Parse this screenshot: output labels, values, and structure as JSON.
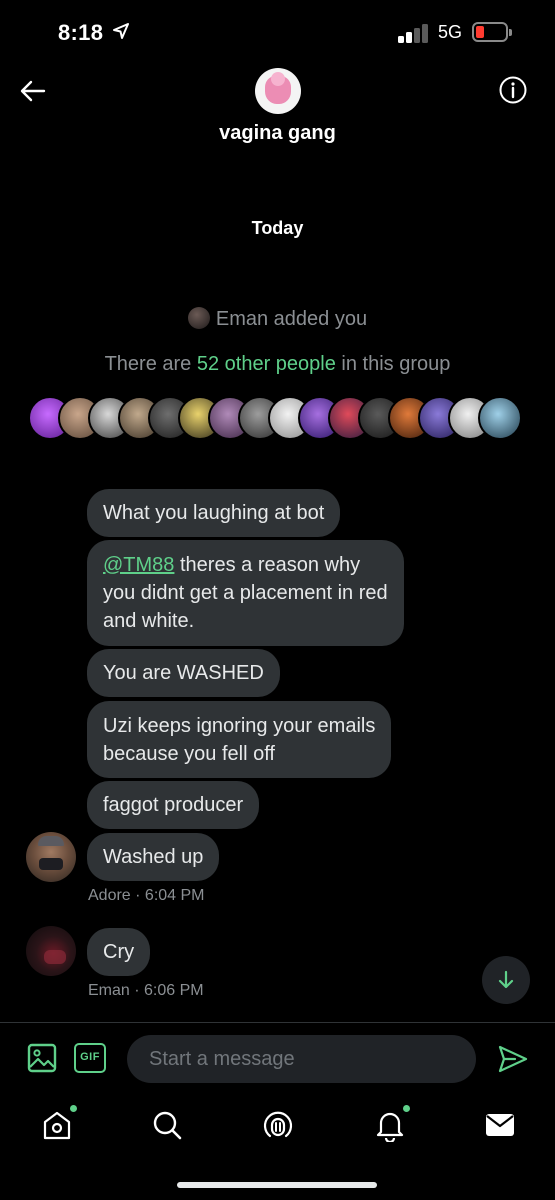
{
  "status_bar": {
    "time": "8:18",
    "network": "5G"
  },
  "header": {
    "group_name": "vagina gang"
  },
  "conversation": {
    "date_separator": "Today",
    "added_event": "Eman added you",
    "members_prefix": "There are ",
    "members_link": "52 other people",
    "members_suffix": " in this group"
  },
  "messages": [
    {
      "text": "What you laughing at bot"
    },
    {
      "mention": "@TM88",
      "text_line1": " theres a reason why",
      "text_line2": "you didnt get a placement in red",
      "text_line3": "and white."
    },
    {
      "text": "You are WASHED"
    },
    {
      "text_line1": "Uzi keeps ignoring your emails",
      "text_line2": "because you fell off"
    },
    {
      "text": "faggot producer"
    },
    {
      "text": "Washed up"
    },
    {
      "text": "Cry"
    }
  ],
  "meta": [
    {
      "sender": "Adore",
      "time": "6:04 PM"
    },
    {
      "sender": "Eman",
      "time": "6:06 PM"
    }
  ],
  "meta_separator": " · ",
  "composer": {
    "placeholder": "Start a message",
    "gif_label": "GIF"
  },
  "colors": {
    "accent": "#5fd08a",
    "bubble": "#2f3336",
    "background": "#000000",
    "muted": "#8b8f93"
  },
  "icons": {
    "header": [
      "back-arrow-icon",
      "info-icon"
    ],
    "composer": [
      "image-icon",
      "gif-icon",
      "send-icon"
    ],
    "tabbar": [
      "home-icon",
      "search-icon",
      "spaces-icon",
      "notifications-icon",
      "messages-icon"
    ]
  }
}
